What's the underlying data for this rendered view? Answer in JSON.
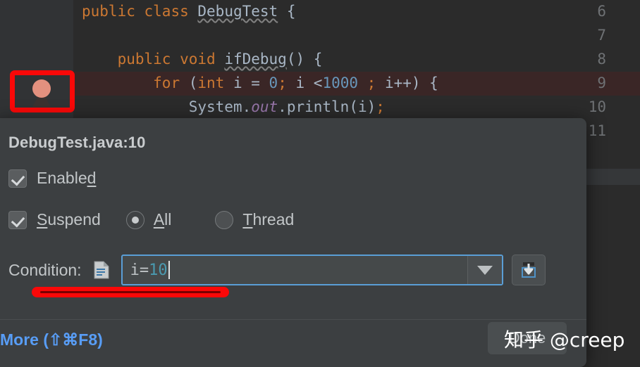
{
  "editor": {
    "line_numbers": [
      "6",
      "7",
      "8",
      "9",
      "10",
      "11"
    ],
    "lines": [
      {
        "num": "6",
        "tokens": [
          {
            "t": "public",
            "c": "kw"
          },
          {
            "t": " ",
            "c": "plain"
          },
          {
            "t": "class",
            "c": "kw"
          },
          {
            "t": " ",
            "c": "plain"
          },
          {
            "t": "DebugTest",
            "c": "cls"
          },
          {
            "t": " {",
            "c": "plain"
          }
        ]
      },
      {
        "num": "7",
        "tokens": []
      },
      {
        "num": "8",
        "tokens": [
          {
            "t": "    ",
            "c": "plain"
          },
          {
            "t": "public",
            "c": "kw"
          },
          {
            "t": " ",
            "c": "plain"
          },
          {
            "t": "void",
            "c": "kw"
          },
          {
            "t": " ",
            "c": "plain"
          },
          {
            "t": "ifDebug",
            "c": "cls"
          },
          {
            "t": "() {",
            "c": "plain"
          }
        ]
      },
      {
        "num": "9",
        "tokens": [
          {
            "t": "        ",
            "c": "plain"
          },
          {
            "t": "for",
            "c": "kw"
          },
          {
            "t": " (",
            "c": "plain"
          },
          {
            "t": "int",
            "c": "kw"
          },
          {
            "t": " i = ",
            "c": "plain"
          },
          {
            "t": "0",
            "c": "num"
          },
          {
            "t": ";",
            "c": "semi"
          },
          {
            "t": " i <",
            "c": "plain"
          },
          {
            "t": "1000",
            "c": "num"
          },
          {
            "t": " ",
            "c": "plain"
          },
          {
            "t": ";",
            "c": "semi"
          },
          {
            "t": " i++) {",
            "c": "plain"
          }
        ]
      },
      {
        "num": "10",
        "tokens": [
          {
            "t": "            ",
            "c": "plain"
          },
          {
            "t": "System.",
            "c": "plain"
          },
          {
            "t": "out",
            "c": "fld"
          },
          {
            "t": ".println(i)",
            "c": "plain"
          },
          {
            "t": ";",
            "c": "semi"
          }
        ]
      },
      {
        "num": "11",
        "tokens": [
          {
            "t": "        }",
            "c": "plain"
          }
        ]
      }
    ],
    "breakpoint_line": "10",
    "breakpoint_icon": "breakpoint-red-dot-icon"
  },
  "dialog": {
    "title": "DebugTest.java:10",
    "enabled": {
      "label_pre": "Enable",
      "label_mnemonic": "d",
      "label_post": "",
      "checked": true
    },
    "suspend": {
      "label_pre": "",
      "label_mnemonic": "S",
      "label_post": "uspend",
      "checked": true
    },
    "suspend_options": [
      {
        "label_pre": "",
        "label_mnemonic": "A",
        "label_post": "ll",
        "selected": true
      },
      {
        "label_pre": "",
        "label_mnemonic": "T",
        "label_post": "hread",
        "selected": false
      }
    ],
    "condition": {
      "label": "Condition:",
      "file_icon": "file-script-icon",
      "value_text": "i=",
      "value_number": "10",
      "dropdown_icon": "chevron-down-icon",
      "expand_icon": "expand-editor-icon"
    },
    "more_link": "More (⇧⌘F8)",
    "done_button": "Done"
  },
  "annotations": {
    "breakpoint_box": "red-rectangle-highlight",
    "condition_underline": "red-underline-highlight"
  },
  "watermark": "知乎 @creep",
  "colors": {
    "editor_bg": "#2b2b2b",
    "gutter_bg": "#313335",
    "dialog_bg": "#3c3f41",
    "accent_blue": "#589df6",
    "annotation_red": "#fa0808",
    "breakpoint_line_bg": "#3a2626",
    "keyword_orange": "#cc7832",
    "number_blue": "#6897bb"
  }
}
